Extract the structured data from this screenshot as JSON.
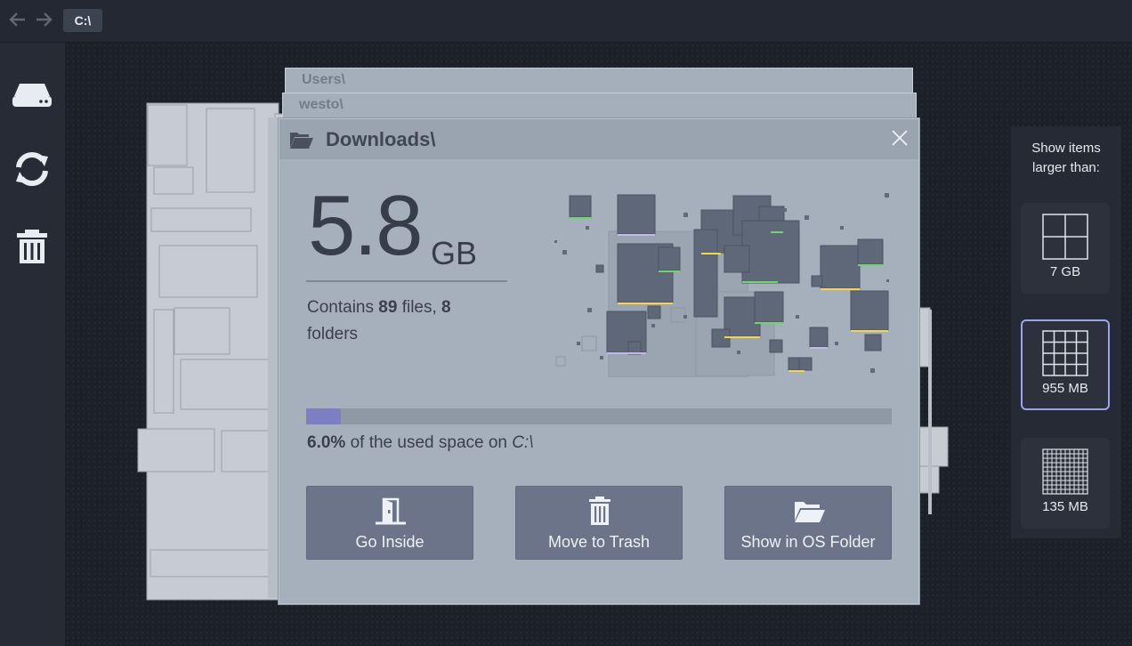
{
  "topbar": {
    "back_icon": "arrow-left-icon",
    "forward_icon": "arrow-right-icon",
    "path": "C:\\"
  },
  "sidebar": {
    "items": [
      {
        "icon": "drive-icon"
      },
      {
        "icon": "refresh-icon"
      },
      {
        "icon": "trash-icon"
      }
    ]
  },
  "breadcrumb_stack": [
    "Users\\",
    "westo\\"
  ],
  "dialog": {
    "title": "Downloads\\",
    "title_icon": "folder-open-icon",
    "close_icon": "close-icon",
    "size_value": "5.8",
    "size_unit": "GB",
    "contains_prefix": "Contains ",
    "file_count": "89",
    "files_word": " files, ",
    "folder_count": "8",
    "folders_word": "folders",
    "usage_percent_value": 6.0,
    "usage_percent": "6.0%",
    "usage_middle": " of the used space on ",
    "usage_drive": "C:\\",
    "buttons": [
      {
        "label": "Go Inside",
        "icon": "door-enter-icon"
      },
      {
        "label": "Move to Trash",
        "icon": "trash-icon"
      },
      {
        "label": "Show in OS Folder",
        "icon": "folder-open-icon"
      }
    ]
  },
  "filter": {
    "title_line1": "Show items",
    "title_line2": "larger than:",
    "options": [
      {
        "label": "7 GB",
        "grid": 2,
        "selected": false
      },
      {
        "label": "955 MB",
        "grid": 4,
        "selected": true
      },
      {
        "label": "135 MB",
        "grid": 10,
        "selected": false
      }
    ]
  },
  "colors": {
    "accent": "#7c80c2",
    "button_bg": "#6b7489",
    "dialog_bg": "#a6b0bc",
    "selected_border": "#9ea3f0"
  }
}
